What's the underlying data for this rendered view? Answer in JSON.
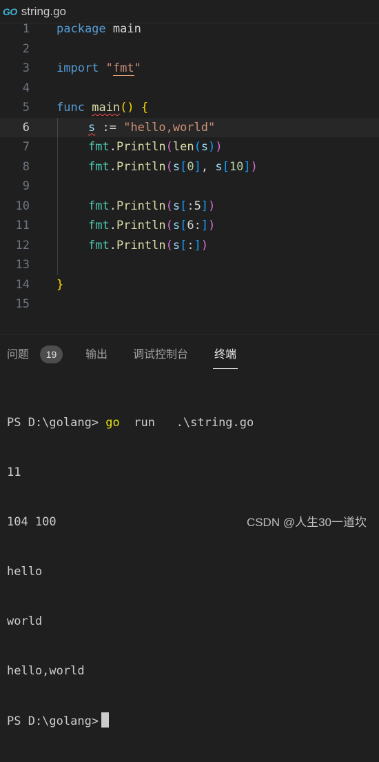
{
  "tab": {
    "icon": "go-file-icon",
    "title": "string.go"
  },
  "editor": {
    "line_numbers": [
      "1",
      "2",
      "3",
      "4",
      "5",
      "6",
      "7",
      "8",
      "9",
      "10",
      "11",
      "12",
      "13",
      "14",
      "15"
    ],
    "code": {
      "l1_kw": "package",
      "l1_name": "main",
      "l3_kw": "import",
      "l3_q1": "\"",
      "l3_pkg": "fmt",
      "l3_q2": "\"",
      "l5_kw": "func",
      "l5_fn": "main",
      "l5_parens": "()",
      "l5_brace": "{",
      "l6_var": "s",
      "l6_op": " := ",
      "l6_str": "\"hello,world\"",
      "l7_pkg": "fmt",
      "l7_fn": "Println",
      "l7_fn2": "len",
      "l7_var": "s",
      "l8_pkg": "fmt",
      "l8_fn": "Println",
      "l8_var1": "s",
      "l8_num1": "0",
      "l8_var2": "s",
      "l8_num2": "10",
      "l10_pkg": "fmt",
      "l10_fn": "Println",
      "l10_var": "s",
      "l10_slice": ":5",
      "l11_pkg": "fmt",
      "l11_fn": "Println",
      "l11_var": "s",
      "l11_slice": "6:",
      "l12_pkg": "fmt",
      "l12_fn": "Println",
      "l12_var": "s",
      "l12_slice": ":",
      "l14_brace": "}"
    }
  },
  "panel": {
    "tabs": {
      "problems": "问题",
      "problems_count": "19",
      "output": "输出",
      "debug_console": "调试控制台",
      "terminal": "终端"
    },
    "terminal": {
      "cmd_prompt": "PS D:\\golang> ",
      "cmd_go": "go",
      "cmd_rest": "  run   .\\string.go",
      "out1": "11",
      "out2": "104 100",
      "out3": "hello",
      "out4": "world",
      "out5": "hello,world",
      "final_prompt": "PS D:\\golang>"
    }
  },
  "watermark": "CSDN @人生30一道坎"
}
